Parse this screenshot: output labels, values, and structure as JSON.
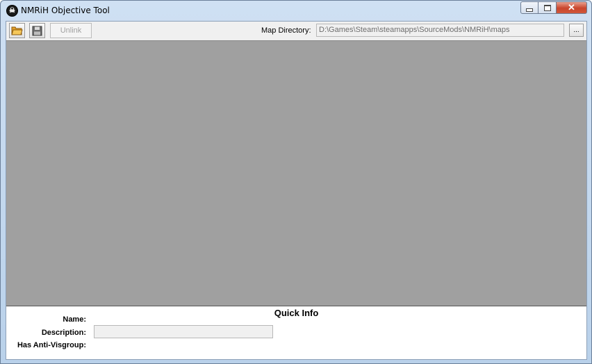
{
  "window": {
    "title": "NMRiH Objective Tool",
    "icon": "nmrih-skull-icon",
    "controls": {
      "minimize": "minimize-icon",
      "maximize": "maximize-icon",
      "close": "✕"
    }
  },
  "toolbar": {
    "open_icon": "open-folder-icon",
    "save_icon": "save-disk-icon",
    "unlink_label": "Unlink",
    "map_directory_label": "Map Directory:",
    "map_directory_value": "D:\\Games\\Steam\\steamapps\\SourceMods\\NMRiH\\maps",
    "browse_label": "..."
  },
  "quick_info": {
    "title": "Quick Info",
    "name_label": "Name:",
    "description_label": "Description:",
    "anti_visgroup_label": "Has Anti-Visgroup:",
    "name_value": "",
    "description_value": "",
    "anti_visgroup_value": ""
  },
  "colors": {
    "canvas_bg": "#a0a0a0",
    "titlebar": "#cfe0f3",
    "close_button": "#c9452c"
  }
}
